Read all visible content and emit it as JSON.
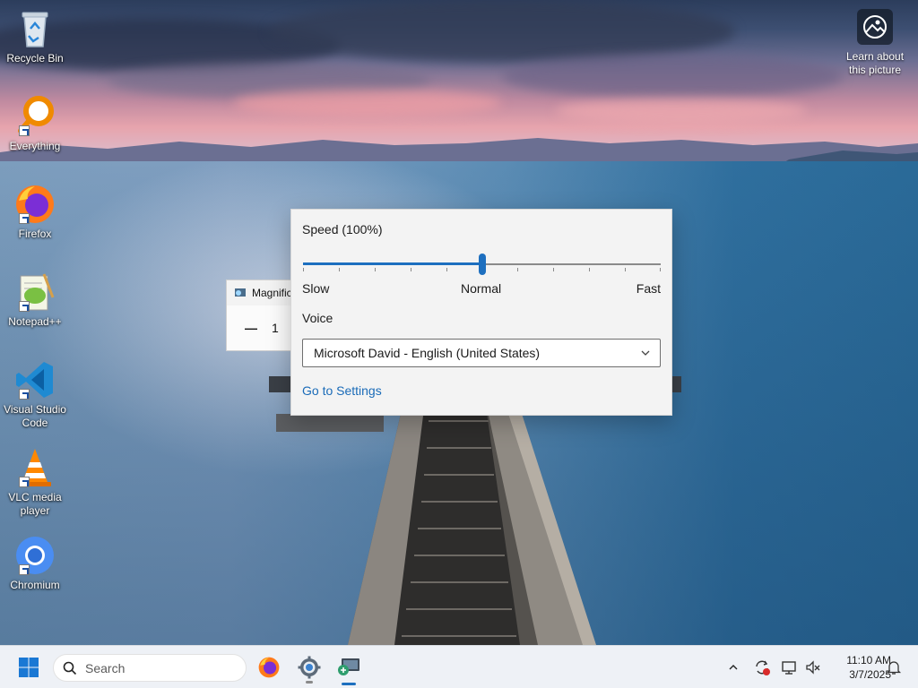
{
  "desktop": {
    "icons": [
      {
        "label": "Recycle Bin",
        "icon": "recycle-bin-icon"
      },
      {
        "label": "Everything",
        "icon": "everything-search-icon"
      },
      {
        "label": "Firefox",
        "icon": "firefox-icon"
      },
      {
        "label": "Notepad++",
        "icon": "notepad-plus-plus-icon"
      },
      {
        "label": "Visual Studio Code",
        "icon": "vscode-icon"
      },
      {
        "label": "VLC media player",
        "icon": "vlc-icon"
      },
      {
        "label": "Chromium",
        "icon": "chromium-icon"
      }
    ],
    "learn_about": "Learn about this picture"
  },
  "magnifier": {
    "title": "Magnific",
    "minus": "—",
    "zoom_partial": "1"
  },
  "reader_flyout": {
    "speed_label": "Speed (100%)",
    "speed_fraction": 0.5,
    "scale_slow": "Slow",
    "scale_normal": "Normal",
    "scale_fast": "Fast",
    "voice_label": "Voice",
    "voice_value": "Microsoft David - English (United States)",
    "settings_link": "Go to Settings",
    "accent_color": "#1d6fbf"
  },
  "taskbar": {
    "search_placeholder": "Search",
    "apps": [
      "firefox-icon",
      "settings-gear-icon",
      "magnifier-icon"
    ],
    "clock_time": "11:10 AM",
    "clock_date": "3/7/2025"
  }
}
